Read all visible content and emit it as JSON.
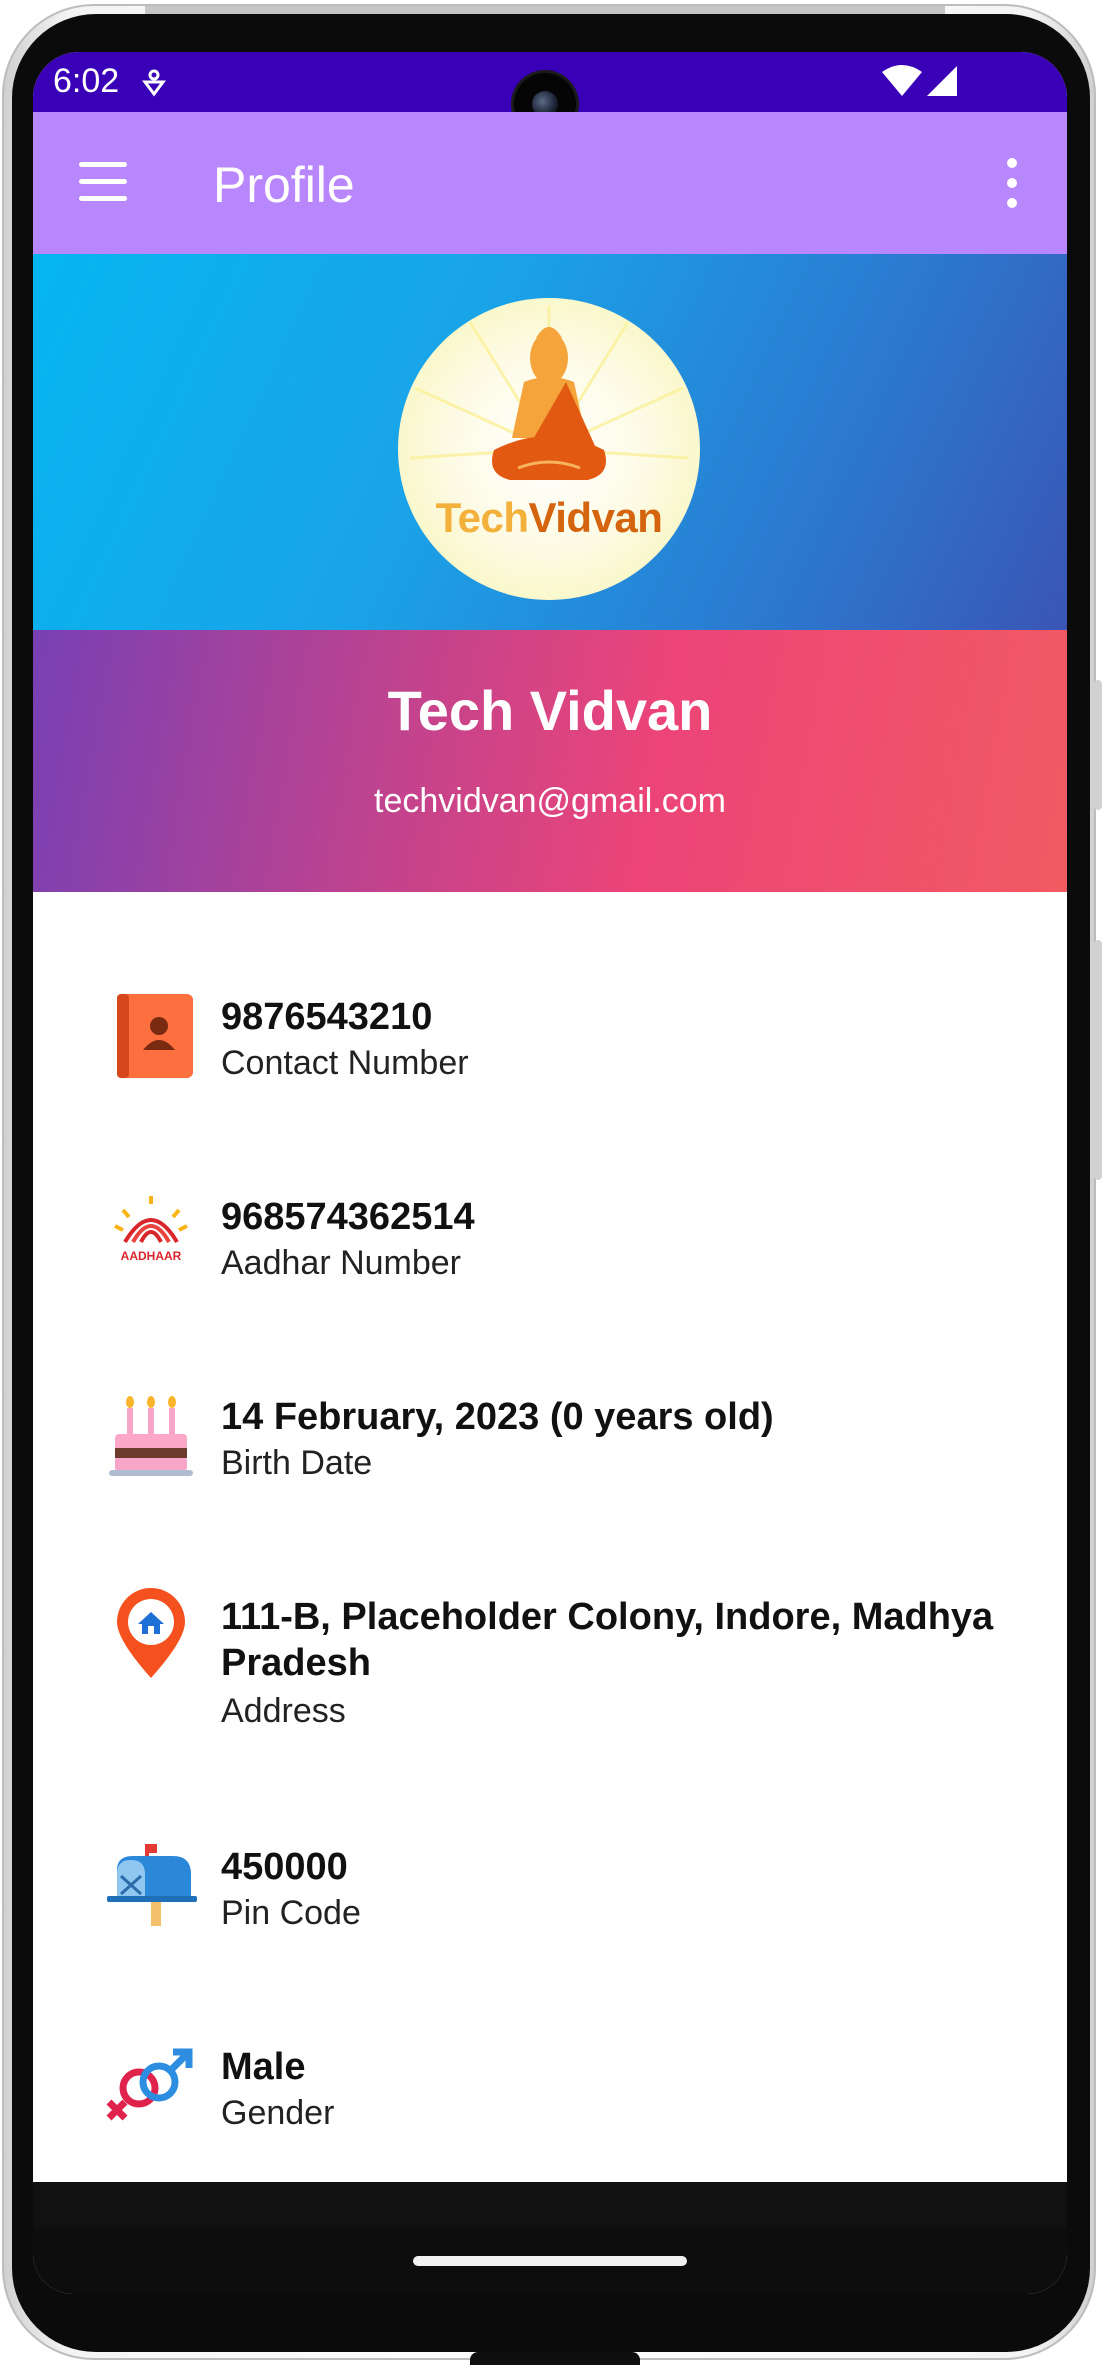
{
  "status_bar": {
    "time": "6:02"
  },
  "app_bar": {
    "title": "Profile",
    "menu_icon": "hamburger-menu-icon",
    "overflow_icon": "more-vert-icon"
  },
  "banner": {
    "logo_word_1": "Tech",
    "logo_word_2": "Vidvan",
    "colors": {
      "banner_start": "#06b6f0",
      "banner_end": "#3a55b5"
    }
  },
  "profile": {
    "name": "Tech Vidvan",
    "email": "techvidvan@gmail.com"
  },
  "details": [
    {
      "icon": "contact-book-icon",
      "value": "9876543210",
      "label": "Contact Number"
    },
    {
      "icon": "aadhaar-logo-icon",
      "value": "968574362514",
      "label": "Aadhar Number"
    },
    {
      "icon": "birthday-cake-icon",
      "value": "14 February, 2023 (0 years old)",
      "label": "Birth Date"
    },
    {
      "icon": "location-pin-home-icon",
      "value": "111-B, Placeholder Colony, Indore, Madhya Pradesh",
      "label": "Address"
    },
    {
      "icon": "mailbox-icon",
      "value": "450000",
      "label": "Pin Code"
    },
    {
      "icon": "gender-symbol-icon",
      "value": "Male",
      "label": "Gender"
    }
  ],
  "colors": {
    "status_bar": "#3a00b7",
    "app_bar": "#b987fd",
    "header_gradient_start": "#7840b4",
    "header_gradient_end": "#f25a62"
  },
  "aadhaar_text": "AADHAAR"
}
